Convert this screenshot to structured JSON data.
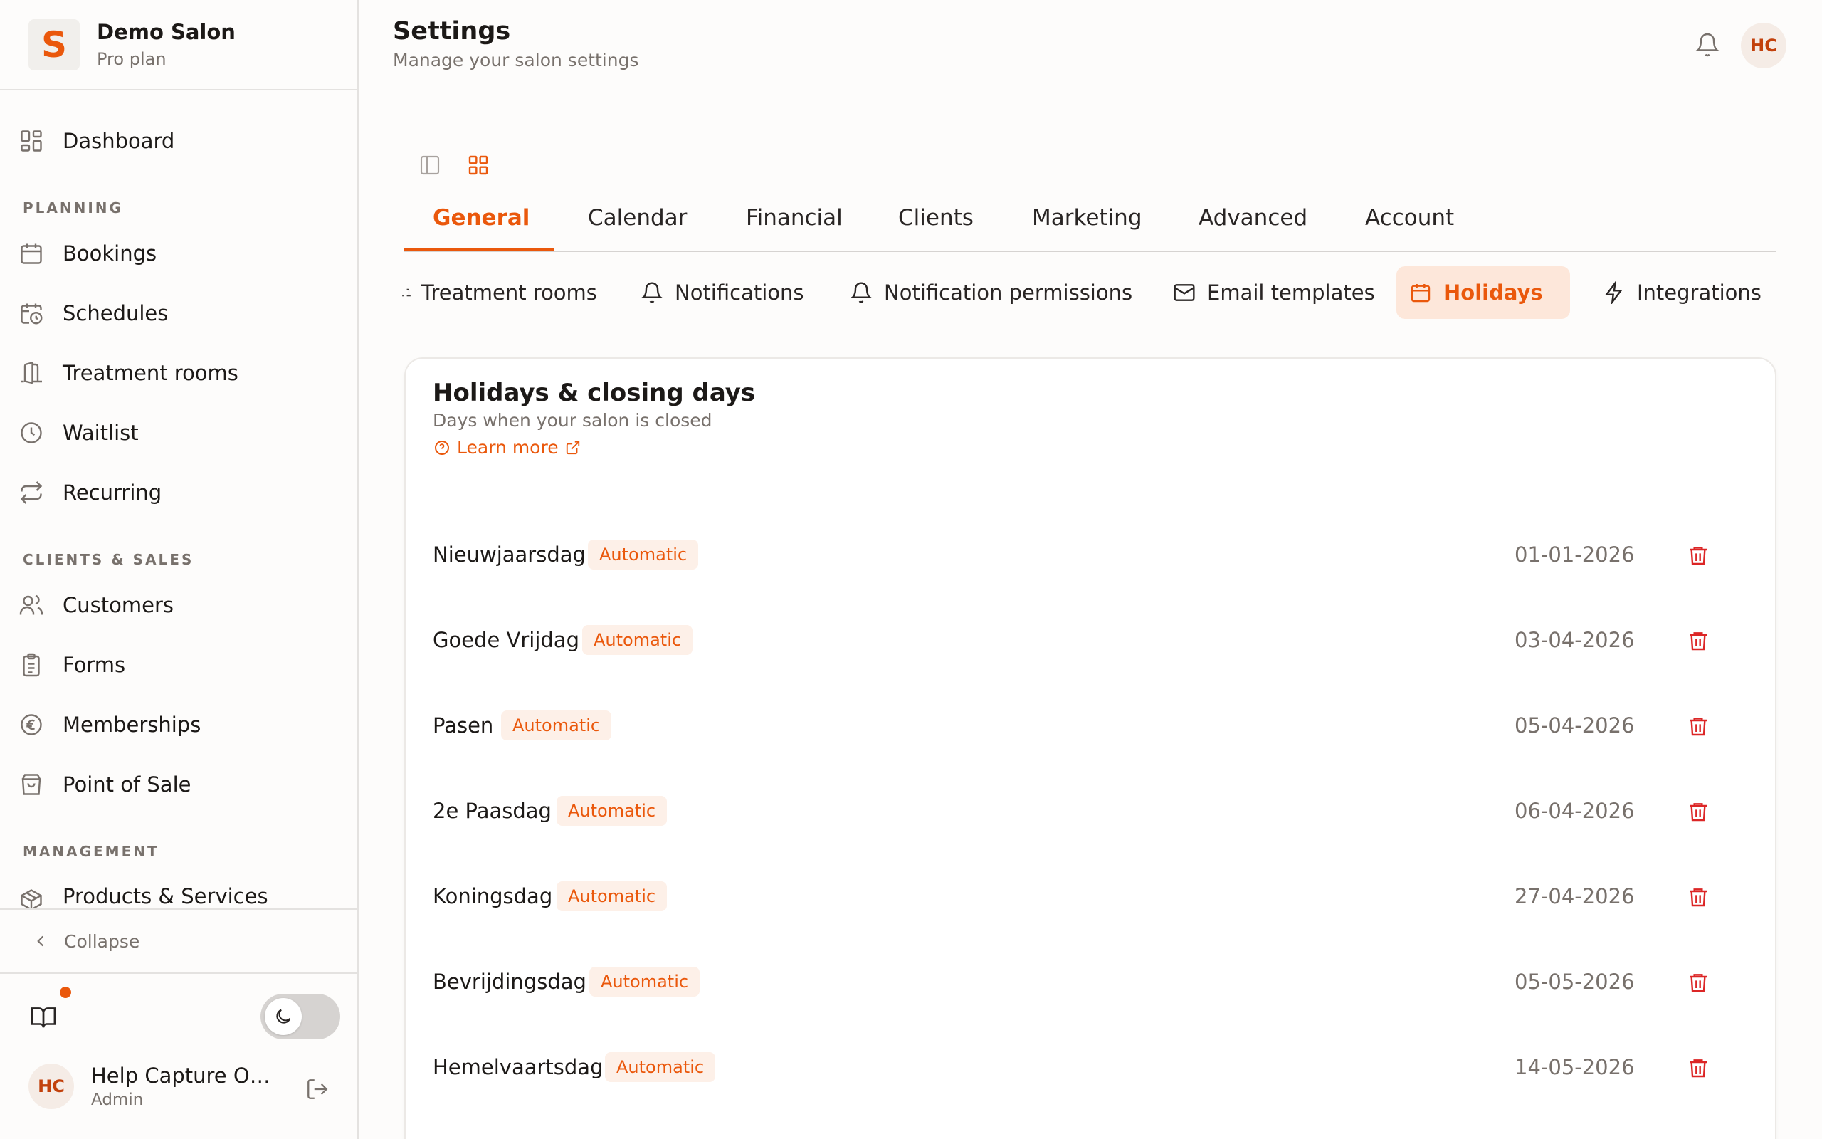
{
  "brand": {
    "logo_letter": "S",
    "name": "Demo Salon",
    "plan": "Pro plan"
  },
  "sidebar": {
    "dashboard": "Dashboard",
    "sections": {
      "planning": "PLANNING",
      "clients_sales": "CLIENTS & SALES",
      "management": "MANAGEMENT"
    },
    "items": [
      {
        "label": "Bookings",
        "icon": "calendar-icon"
      },
      {
        "label": "Schedules",
        "icon": "calendar-clock-icon"
      },
      {
        "label": "Treatment rooms",
        "icon": "door-icon"
      },
      {
        "label": "Waitlist",
        "icon": "clock-icon"
      },
      {
        "label": "Recurring",
        "icon": "repeat-icon"
      },
      {
        "label": "Customers",
        "icon": "users-icon"
      },
      {
        "label": "Forms",
        "icon": "clipboard-icon"
      },
      {
        "label": "Memberships",
        "icon": "euro-icon"
      },
      {
        "label": "Point of Sale",
        "icon": "shopping-bag-icon"
      },
      {
        "label": "Products & Services",
        "icon": "package-icon"
      }
    ],
    "collapse": "Collapse"
  },
  "user": {
    "initials": "HC",
    "name": "Help Capture Ow...",
    "role": "Admin"
  },
  "header": {
    "title": "Settings",
    "subtitle": "Manage your salon settings",
    "avatar_initials": "HC"
  },
  "main_tabs": [
    {
      "label": "General",
      "active": true
    },
    {
      "label": "Calendar"
    },
    {
      "label": "Financial"
    },
    {
      "label": "Clients"
    },
    {
      "label": "Marketing"
    },
    {
      "label": "Advanced"
    },
    {
      "label": "Account"
    }
  ],
  "sub_tabs": [
    {
      "label": "Treatment rooms",
      "icon": "door-icon"
    },
    {
      "label": "Notifications",
      "icon": "bell-icon"
    },
    {
      "label": "Notification permissions",
      "icon": "bell-icon"
    },
    {
      "label": "Email templates",
      "icon": "mail-icon"
    },
    {
      "label": "Holidays",
      "icon": "calendar-icon",
      "active": true
    },
    {
      "label": "Integrations",
      "icon": "zap-icon"
    }
  ],
  "card": {
    "title": "Holidays & closing days",
    "description": "Days when your salon is closed",
    "learn_more": "Learn more"
  },
  "holidays": [
    {
      "name": "Nieuwjaarsdag",
      "badge": "Automatic",
      "date": "01-01-2026"
    },
    {
      "name": "Goede Vrijdag",
      "badge": "Automatic",
      "date": "03-04-2026"
    },
    {
      "name": "Pasen",
      "badge": "Automatic",
      "date": "05-04-2026"
    },
    {
      "name": "2e Paasdag",
      "badge": "Automatic",
      "date": "06-04-2026"
    },
    {
      "name": "Koningsdag",
      "badge": "Automatic",
      "date": "27-04-2026"
    },
    {
      "name": "Bevrijdingsdag",
      "badge": "Automatic",
      "date": "05-05-2026"
    },
    {
      "name": "Hemelvaartsdag",
      "badge": "Automatic",
      "date": "14-05-2026"
    }
  ],
  "colors": {
    "accent": "#ea580c",
    "danger": "#dc2626",
    "muted": "#78716c",
    "badge_bg": "#fdf0e8"
  }
}
